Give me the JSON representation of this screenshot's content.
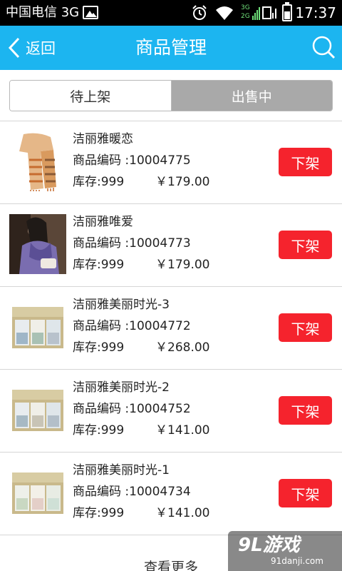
{
  "status_bar": {
    "carrier": "中国电信 3G",
    "net_top": "3G",
    "net_bottom": "2G",
    "time": "17:37",
    "battery_level": 0.6
  },
  "nav": {
    "back_label": "返回",
    "title": "商品管理",
    "icons": {
      "back": "chevron-left-icon",
      "search": "search-icon"
    }
  },
  "tabs": [
    {
      "label": "待上架",
      "selected": false
    },
    {
      "label": "出售中",
      "selected": true
    }
  ],
  "products": [
    {
      "name": "洁丽雅暖恋",
      "code_label": "商品编码 :",
      "code": "10004775",
      "stock_label": "库存:",
      "stock": "999",
      "price": "￥179.00",
      "action": "下架",
      "thumb": "scarf"
    },
    {
      "name": "洁丽雅唯爱",
      "code_label": "商品编码 :",
      "code": "10004773",
      "stock_label": "库存:",
      "stock": "999",
      "price": "￥179.00",
      "action": "下架",
      "thumb": "woman"
    },
    {
      "name": "洁丽雅美丽时光-3",
      "code_label": "商品编码 :",
      "code": "10004772",
      "stock_label": "库存:",
      "stock": "999",
      "price": "￥268.00",
      "action": "下架",
      "thumb": "giftbox"
    },
    {
      "name": "洁丽雅美丽时光-2",
      "code_label": "商品编码 :",
      "code": "10004752",
      "stock_label": "库存:",
      "stock": "999",
      "price": "￥141.00",
      "action": "下架",
      "thumb": "giftbox"
    },
    {
      "name": "洁丽雅美丽时光-1",
      "code_label": "商品编码 :",
      "code": "10004734",
      "stock_label": "库存:",
      "stock": "999",
      "price": "￥141.00",
      "action": "下架",
      "thumb": "giftbox"
    }
  ],
  "load_more": "查看更多",
  "watermark": {
    "main": "9L游戏",
    "sub": "91danji.com"
  },
  "colors": {
    "nav_bg": "#1cb5f0",
    "delist_button": "#f5232d",
    "selected_tab": "#a9a9a9"
  }
}
